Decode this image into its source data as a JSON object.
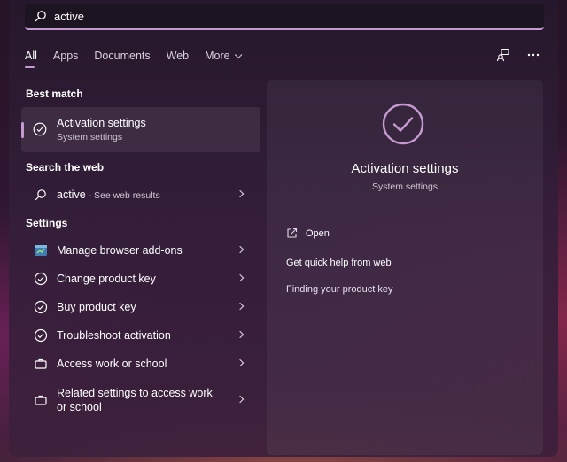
{
  "search": {
    "value": "active"
  },
  "tabs": [
    {
      "label": "All",
      "active": true
    },
    {
      "label": "Apps"
    },
    {
      "label": "Documents"
    },
    {
      "label": "Web"
    },
    {
      "label": "More"
    }
  ],
  "sections": {
    "best_match": "Best match",
    "search_web": "Search the web",
    "settings": "Settings"
  },
  "best_match": {
    "title": "Activation settings",
    "subtitle": "System settings",
    "icon": "check-circle-icon"
  },
  "web_result": {
    "query": "active",
    "suffix": " - See web results",
    "icon": "search-icon"
  },
  "settings_items": [
    {
      "label": "Manage browser add-ons",
      "icon": "browser-addons-icon"
    },
    {
      "label": "Change product key",
      "icon": "check-circle-icon"
    },
    {
      "label": "Buy product key",
      "icon": "check-circle-icon"
    },
    {
      "label": "Troubleshoot activation",
      "icon": "check-circle-icon"
    },
    {
      "label": "Access work or school",
      "icon": "briefcase-icon"
    },
    {
      "label": "Related settings to access work or school",
      "icon": "briefcase-icon"
    }
  ],
  "preview": {
    "title": "Activation settings",
    "subtitle": "System settings",
    "open_label": "Open",
    "help_label": "Get quick help from web",
    "link_label": "Finding your product key"
  },
  "colors": {
    "accent": "#c49ad0"
  }
}
